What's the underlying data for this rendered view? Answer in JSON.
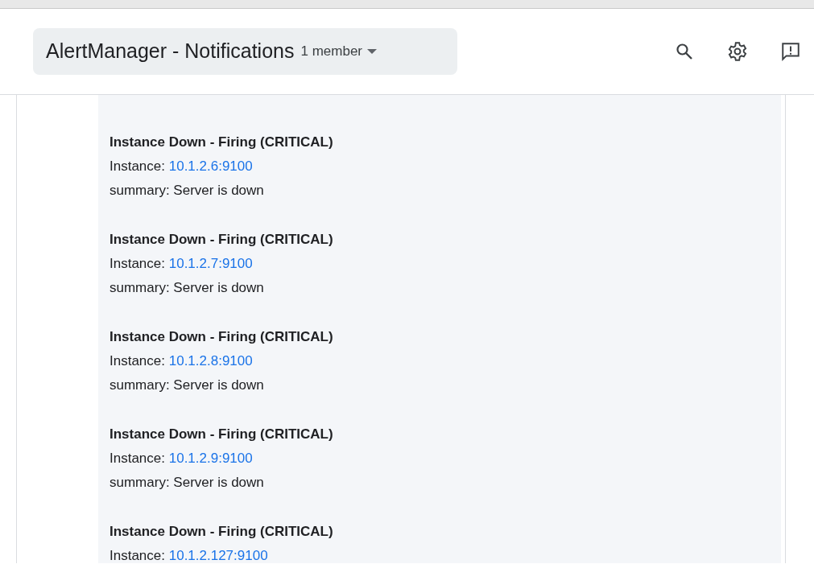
{
  "header": {
    "title": "AlertManager - Notifications",
    "members": "1 member"
  },
  "messages": [
    {
      "title": "Instance Down - Firing (CRITICAL)",
      "instance_label": "Instance:",
      "instance": "10.1.2.6:9100",
      "summary": "summary: Server is down"
    },
    {
      "title": "Instance Down - Firing (CRITICAL)",
      "instance_label": "Instance:",
      "instance": "10.1.2.7:9100",
      "summary": "summary: Server is down"
    },
    {
      "title": "Instance Down - Firing (CRITICAL)",
      "instance_label": "Instance:",
      "instance": "10.1.2.8:9100",
      "summary": "summary: Server is down"
    },
    {
      "title": "Instance Down - Firing (CRITICAL)",
      "instance_label": "Instance:",
      "instance": "10.1.2.9:9100",
      "summary": "summary: Server is down"
    },
    {
      "title": "Instance Down - Firing (CRITICAL)",
      "instance_label": "Instance:",
      "instance": "10.1.2.127:9100"
    }
  ]
}
